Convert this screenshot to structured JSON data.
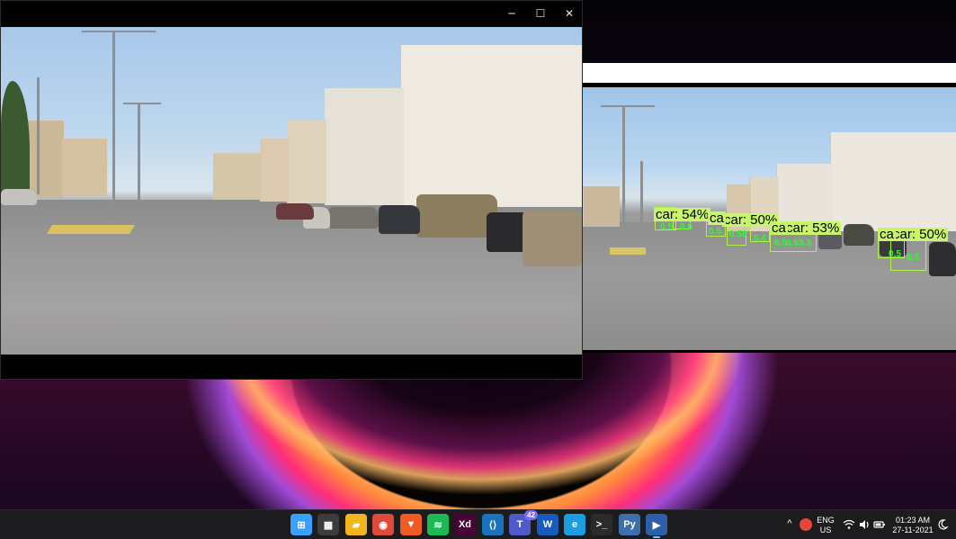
{
  "video_window": {
    "controls": {
      "minimize_glyph": "─",
      "maximize_glyph": "☐",
      "close_glyph": "✕"
    }
  },
  "detection_window": {
    "detections": [
      {
        "label": "car: 54%"
      },
      {
        "label": "car: 50%"
      },
      {
        "label": "ca"
      },
      {
        "label": "car: 53%"
      },
      {
        "label": "ca"
      },
      {
        "label": "car: 50%"
      },
      {
        "label": "ca"
      }
    ],
    "small_scores": [
      "0.5",
      "0.6",
      "0.5",
      "0.58",
      "0.4",
      "0.5",
      "0.63.3",
      "0.5",
      "0.5"
    ]
  },
  "taskbar": {
    "apps": [
      {
        "name": "windows-start",
        "glyph": "⊞",
        "color": "#3aa0ff"
      },
      {
        "name": "microsoft-store",
        "glyph": "▦",
        "color": "#3c3c3c"
      },
      {
        "name": "file-explorer",
        "glyph": "▰",
        "color": "#f2b51d"
      },
      {
        "name": "chrome",
        "glyph": "◉",
        "color": "#e04a3a"
      },
      {
        "name": "brave",
        "glyph": "▼",
        "color": "#f25a24"
      },
      {
        "name": "spotify",
        "glyph": "≋",
        "color": "#1db954"
      },
      {
        "name": "adobe-xd",
        "glyph": "Xd",
        "color": "#470137"
      },
      {
        "name": "vscode",
        "glyph": "⟨⟩",
        "color": "#1b73c0"
      },
      {
        "name": "teams",
        "glyph": "T",
        "color": "#5059c9",
        "badge": "42"
      },
      {
        "name": "word",
        "glyph": "W",
        "color": "#185abd"
      },
      {
        "name": "edge",
        "glyph": "e",
        "color": "#1b9de2"
      },
      {
        "name": "terminal",
        "glyph": ">_",
        "color": "#2b2b2b"
      },
      {
        "name": "python",
        "glyph": "Py",
        "color": "#3d6fa8"
      },
      {
        "name": "media-player",
        "glyph": "▶",
        "color": "#2c5fa8"
      }
    ],
    "tray": {
      "chevron": "^",
      "lang_top": "ENG",
      "lang_bottom": "US",
      "time": "01:23 AM",
      "date": "27-11-2021"
    }
  }
}
